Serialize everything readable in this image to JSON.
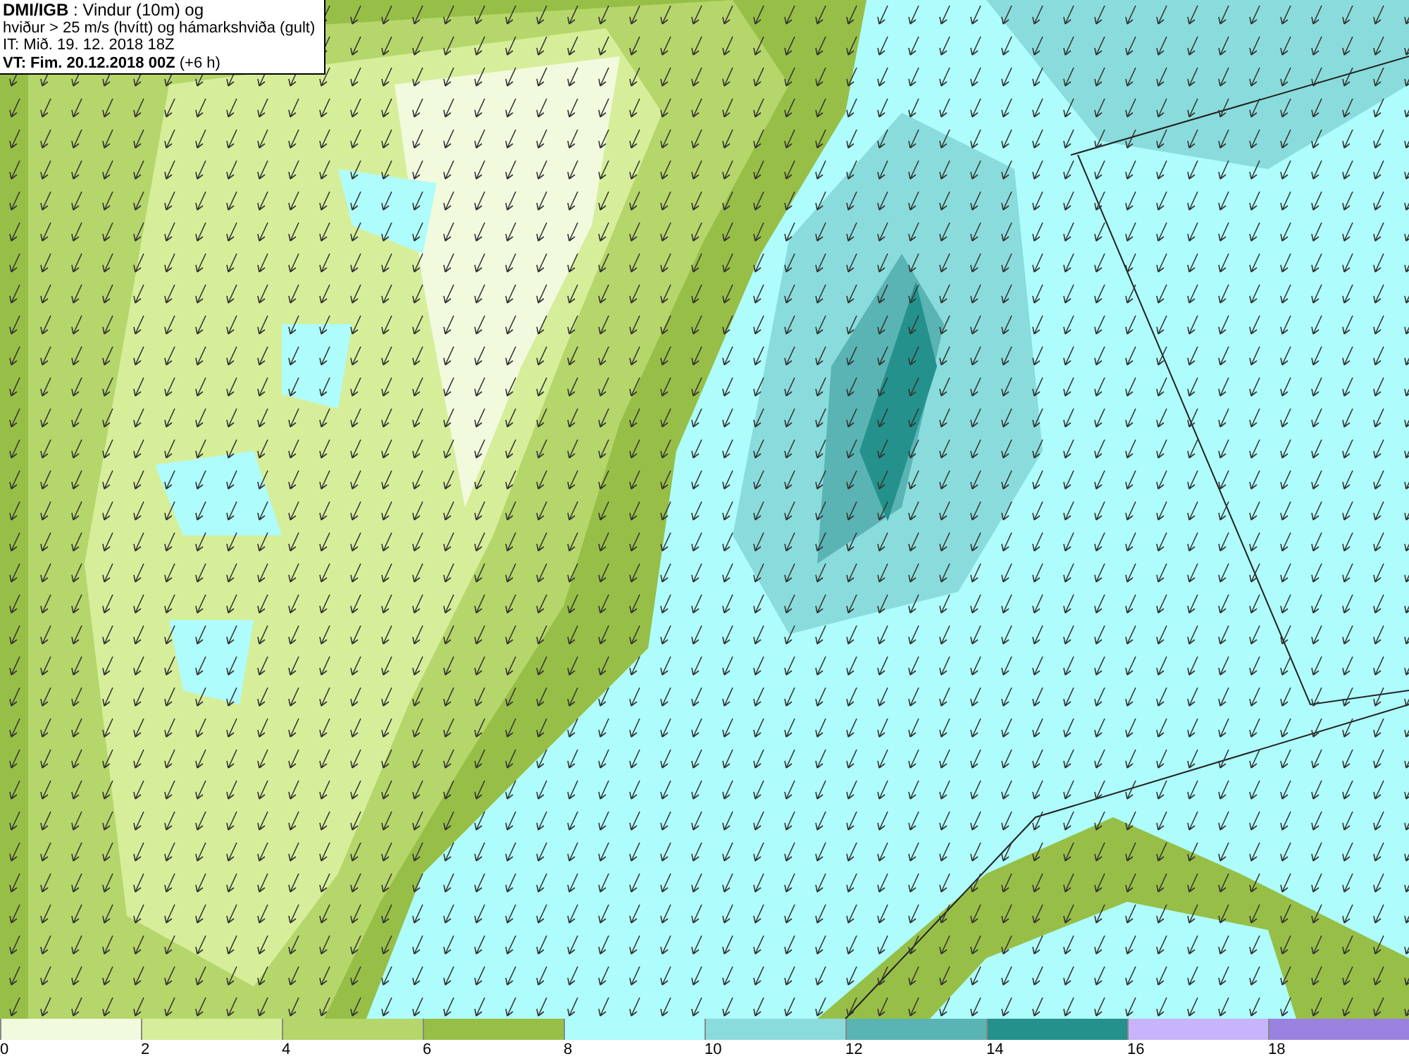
{
  "header": {
    "lines": [
      "**DMI/IGB** : Vindur (10m) og",
      "hviður > 25 m/s (hvítt) og hámarkshviða (gult)",
      "IT: Mið. 19. 12. 2018 18Z",
      "**VT: Fim. 20.12.2018 00Z** (+6 h)"
    ]
  },
  "legend": [
    {
      "label": "0",
      "color": "#f2fade"
    },
    {
      "label": "2",
      "color": "#d6ee9a"
    },
    {
      "label": "4",
      "color": "#b5d66a"
    },
    {
      "label": "6",
      "color": "#97bf47"
    },
    {
      "label": "8",
      "color": "#aefcfc"
    },
    {
      "label": "10",
      "color": "#8adcdc"
    },
    {
      "label": "12",
      "color": "#5ab4b4"
    },
    {
      "label": "14",
      "color": "#24918c"
    },
    {
      "label": "16",
      "color": "#c8b4fa"
    },
    {
      "label": "18",
      "color": "#9b82e0"
    }
  ]
}
